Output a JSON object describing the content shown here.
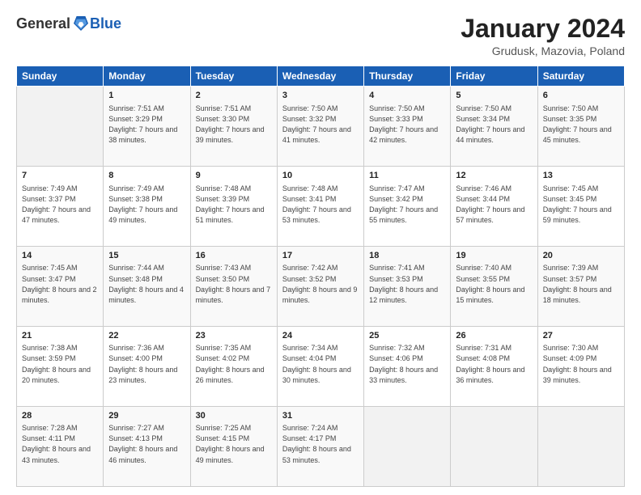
{
  "logo": {
    "general": "General",
    "blue": "Blue"
  },
  "header": {
    "title": "January 2024",
    "subtitle": "Grudusk, Mazovia, Poland"
  },
  "days_of_week": [
    "Sunday",
    "Monday",
    "Tuesday",
    "Wednesday",
    "Thursday",
    "Friday",
    "Saturday"
  ],
  "weeks": [
    [
      {
        "day": "",
        "sunrise": "",
        "sunset": "",
        "daylight": ""
      },
      {
        "day": "1",
        "sunrise": "Sunrise: 7:51 AM",
        "sunset": "Sunset: 3:29 PM",
        "daylight": "Daylight: 7 hours and 38 minutes."
      },
      {
        "day": "2",
        "sunrise": "Sunrise: 7:51 AM",
        "sunset": "Sunset: 3:30 PM",
        "daylight": "Daylight: 7 hours and 39 minutes."
      },
      {
        "day": "3",
        "sunrise": "Sunrise: 7:50 AM",
        "sunset": "Sunset: 3:32 PM",
        "daylight": "Daylight: 7 hours and 41 minutes."
      },
      {
        "day": "4",
        "sunrise": "Sunrise: 7:50 AM",
        "sunset": "Sunset: 3:33 PM",
        "daylight": "Daylight: 7 hours and 42 minutes."
      },
      {
        "day": "5",
        "sunrise": "Sunrise: 7:50 AM",
        "sunset": "Sunset: 3:34 PM",
        "daylight": "Daylight: 7 hours and 44 minutes."
      },
      {
        "day": "6",
        "sunrise": "Sunrise: 7:50 AM",
        "sunset": "Sunset: 3:35 PM",
        "daylight": "Daylight: 7 hours and 45 minutes."
      }
    ],
    [
      {
        "day": "7",
        "sunrise": "Sunrise: 7:49 AM",
        "sunset": "Sunset: 3:37 PM",
        "daylight": "Daylight: 7 hours and 47 minutes."
      },
      {
        "day": "8",
        "sunrise": "Sunrise: 7:49 AM",
        "sunset": "Sunset: 3:38 PM",
        "daylight": "Daylight: 7 hours and 49 minutes."
      },
      {
        "day": "9",
        "sunrise": "Sunrise: 7:48 AM",
        "sunset": "Sunset: 3:39 PM",
        "daylight": "Daylight: 7 hours and 51 minutes."
      },
      {
        "day": "10",
        "sunrise": "Sunrise: 7:48 AM",
        "sunset": "Sunset: 3:41 PM",
        "daylight": "Daylight: 7 hours and 53 minutes."
      },
      {
        "day": "11",
        "sunrise": "Sunrise: 7:47 AM",
        "sunset": "Sunset: 3:42 PM",
        "daylight": "Daylight: 7 hours and 55 minutes."
      },
      {
        "day": "12",
        "sunrise": "Sunrise: 7:46 AM",
        "sunset": "Sunset: 3:44 PM",
        "daylight": "Daylight: 7 hours and 57 minutes."
      },
      {
        "day": "13",
        "sunrise": "Sunrise: 7:45 AM",
        "sunset": "Sunset: 3:45 PM",
        "daylight": "Daylight: 7 hours and 59 minutes."
      }
    ],
    [
      {
        "day": "14",
        "sunrise": "Sunrise: 7:45 AM",
        "sunset": "Sunset: 3:47 PM",
        "daylight": "Daylight: 8 hours and 2 minutes."
      },
      {
        "day": "15",
        "sunrise": "Sunrise: 7:44 AM",
        "sunset": "Sunset: 3:48 PM",
        "daylight": "Daylight: 8 hours and 4 minutes."
      },
      {
        "day": "16",
        "sunrise": "Sunrise: 7:43 AM",
        "sunset": "Sunset: 3:50 PM",
        "daylight": "Daylight: 8 hours and 7 minutes."
      },
      {
        "day": "17",
        "sunrise": "Sunrise: 7:42 AM",
        "sunset": "Sunset: 3:52 PM",
        "daylight": "Daylight: 8 hours and 9 minutes."
      },
      {
        "day": "18",
        "sunrise": "Sunrise: 7:41 AM",
        "sunset": "Sunset: 3:53 PM",
        "daylight": "Daylight: 8 hours and 12 minutes."
      },
      {
        "day": "19",
        "sunrise": "Sunrise: 7:40 AM",
        "sunset": "Sunset: 3:55 PM",
        "daylight": "Daylight: 8 hours and 15 minutes."
      },
      {
        "day": "20",
        "sunrise": "Sunrise: 7:39 AM",
        "sunset": "Sunset: 3:57 PM",
        "daylight": "Daylight: 8 hours and 18 minutes."
      }
    ],
    [
      {
        "day": "21",
        "sunrise": "Sunrise: 7:38 AM",
        "sunset": "Sunset: 3:59 PM",
        "daylight": "Daylight: 8 hours and 20 minutes."
      },
      {
        "day": "22",
        "sunrise": "Sunrise: 7:36 AM",
        "sunset": "Sunset: 4:00 PM",
        "daylight": "Daylight: 8 hours and 23 minutes."
      },
      {
        "day": "23",
        "sunrise": "Sunrise: 7:35 AM",
        "sunset": "Sunset: 4:02 PM",
        "daylight": "Daylight: 8 hours and 26 minutes."
      },
      {
        "day": "24",
        "sunrise": "Sunrise: 7:34 AM",
        "sunset": "Sunset: 4:04 PM",
        "daylight": "Daylight: 8 hours and 30 minutes."
      },
      {
        "day": "25",
        "sunrise": "Sunrise: 7:32 AM",
        "sunset": "Sunset: 4:06 PM",
        "daylight": "Daylight: 8 hours and 33 minutes."
      },
      {
        "day": "26",
        "sunrise": "Sunrise: 7:31 AM",
        "sunset": "Sunset: 4:08 PM",
        "daylight": "Daylight: 8 hours and 36 minutes."
      },
      {
        "day": "27",
        "sunrise": "Sunrise: 7:30 AM",
        "sunset": "Sunset: 4:09 PM",
        "daylight": "Daylight: 8 hours and 39 minutes."
      }
    ],
    [
      {
        "day": "28",
        "sunrise": "Sunrise: 7:28 AM",
        "sunset": "Sunset: 4:11 PM",
        "daylight": "Daylight: 8 hours and 43 minutes."
      },
      {
        "day": "29",
        "sunrise": "Sunrise: 7:27 AM",
        "sunset": "Sunset: 4:13 PM",
        "daylight": "Daylight: 8 hours and 46 minutes."
      },
      {
        "day": "30",
        "sunrise": "Sunrise: 7:25 AM",
        "sunset": "Sunset: 4:15 PM",
        "daylight": "Daylight: 8 hours and 49 minutes."
      },
      {
        "day": "31",
        "sunrise": "Sunrise: 7:24 AM",
        "sunset": "Sunset: 4:17 PM",
        "daylight": "Daylight: 8 hours and 53 minutes."
      },
      {
        "day": "",
        "sunrise": "",
        "sunset": "",
        "daylight": ""
      },
      {
        "day": "",
        "sunrise": "",
        "sunset": "",
        "daylight": ""
      },
      {
        "day": "",
        "sunrise": "",
        "sunset": "",
        "daylight": ""
      }
    ]
  ]
}
